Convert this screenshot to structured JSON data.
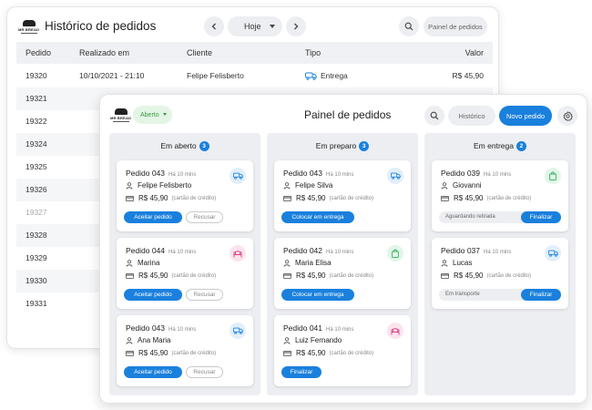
{
  "brand": {
    "logo_text": "MR BREAD"
  },
  "history": {
    "title": "Histórico de pedidos",
    "date_filter": "Hoje",
    "panel_button": "Painel de pedidos",
    "columns": {
      "order": "Pedido",
      "date": "Realizado em",
      "client": "Cliente",
      "type": "Tipo",
      "value": "Valor"
    },
    "first_row": {
      "order": "19320",
      "date": "10/10/2021 - 21:10",
      "client": "Felipe Felisberto",
      "type": "Entrega",
      "value": "R$ 45,90"
    },
    "order_ids": [
      "19321",
      "19322",
      "19324",
      "19325",
      "19326",
      "19327",
      "19328",
      "19329",
      "19330",
      "19331"
    ]
  },
  "board": {
    "status_filter": "Aberto",
    "title": "Painel de pedidos",
    "history_button": "Histórico",
    "new_order_button": "Novo pedido",
    "columns": {
      "open": {
        "title": "Em aberto",
        "count": "3",
        "cards": [
          {
            "order": "Pedido 043",
            "time": "Há 10 mins",
            "customer": "Felipe Felisberto",
            "price": "R$ 45,90",
            "payment": "(cartão de crédito)",
            "type": "delivery-icon",
            "accept": "Aceitar pedido",
            "reject": "Recusar"
          },
          {
            "order": "Pedido 044",
            "time": "Há 10 mins",
            "customer": "Marina",
            "price": "R$ 45,90",
            "payment": "(cartão de crédito)",
            "type": "dine-in-icon",
            "accept": "Aceitar pedido",
            "reject": "Recusar"
          },
          {
            "order": "Pedido 043",
            "time": "Há 10 mins",
            "customer": "Ana Maria",
            "price": "R$ 45,90",
            "payment": "(cartão de crédito)",
            "type": "delivery-icon",
            "accept": "Aceitar pedido",
            "reject": "Recusar"
          }
        ]
      },
      "preparing": {
        "title": "Em preparo",
        "count": "3",
        "cards": [
          {
            "order": "Pedido 043",
            "time": "Há 10 mins",
            "customer": "Felipe Silva",
            "price": "R$ 45,90",
            "payment": "(cartão de crédito)",
            "type": "delivery-icon",
            "action": "Colocar em entrega"
          },
          {
            "order": "Pedido 042",
            "time": "Há 10 mins",
            "customer": "Maria Elisa",
            "price": "R$ 45,90",
            "payment": "(cartão de crédito)",
            "type": "pickup-bag-icon",
            "action": "Colocar em entrega"
          },
          {
            "order": "Pedido 041",
            "time": "Há 10 mins",
            "customer": "Luiz Fernando",
            "price": "R$ 45,90",
            "payment": "(cartão de crédito)",
            "type": "dine-in-icon",
            "action": "Finalizar"
          }
        ]
      },
      "delivering": {
        "title": "Em entrega",
        "count": "2",
        "cards": [
          {
            "order": "Pedido 039",
            "time": "Há 10 mins",
            "customer": "Giovanni",
            "price": "R$ 45,90",
            "payment": "(cartão de crédito)",
            "type": "pickup-bag-icon",
            "status": "Aguardando retirada",
            "action": "Finalizar"
          },
          {
            "order": "Pedido 037",
            "time": "Há 10 mins",
            "customer": "Lucas",
            "price": "R$ 45,90",
            "payment": "(cartão de crédito)",
            "type": "delivery-icon",
            "status": "Em transporte",
            "action": "Finalizar"
          }
        ]
      }
    }
  },
  "colors": {
    "primary": "#1a80dd",
    "open_filter": "#3a9a41",
    "delivery": "#1a80dd",
    "pickup": "#2fae5a",
    "dine_in": "#d63b7c"
  }
}
